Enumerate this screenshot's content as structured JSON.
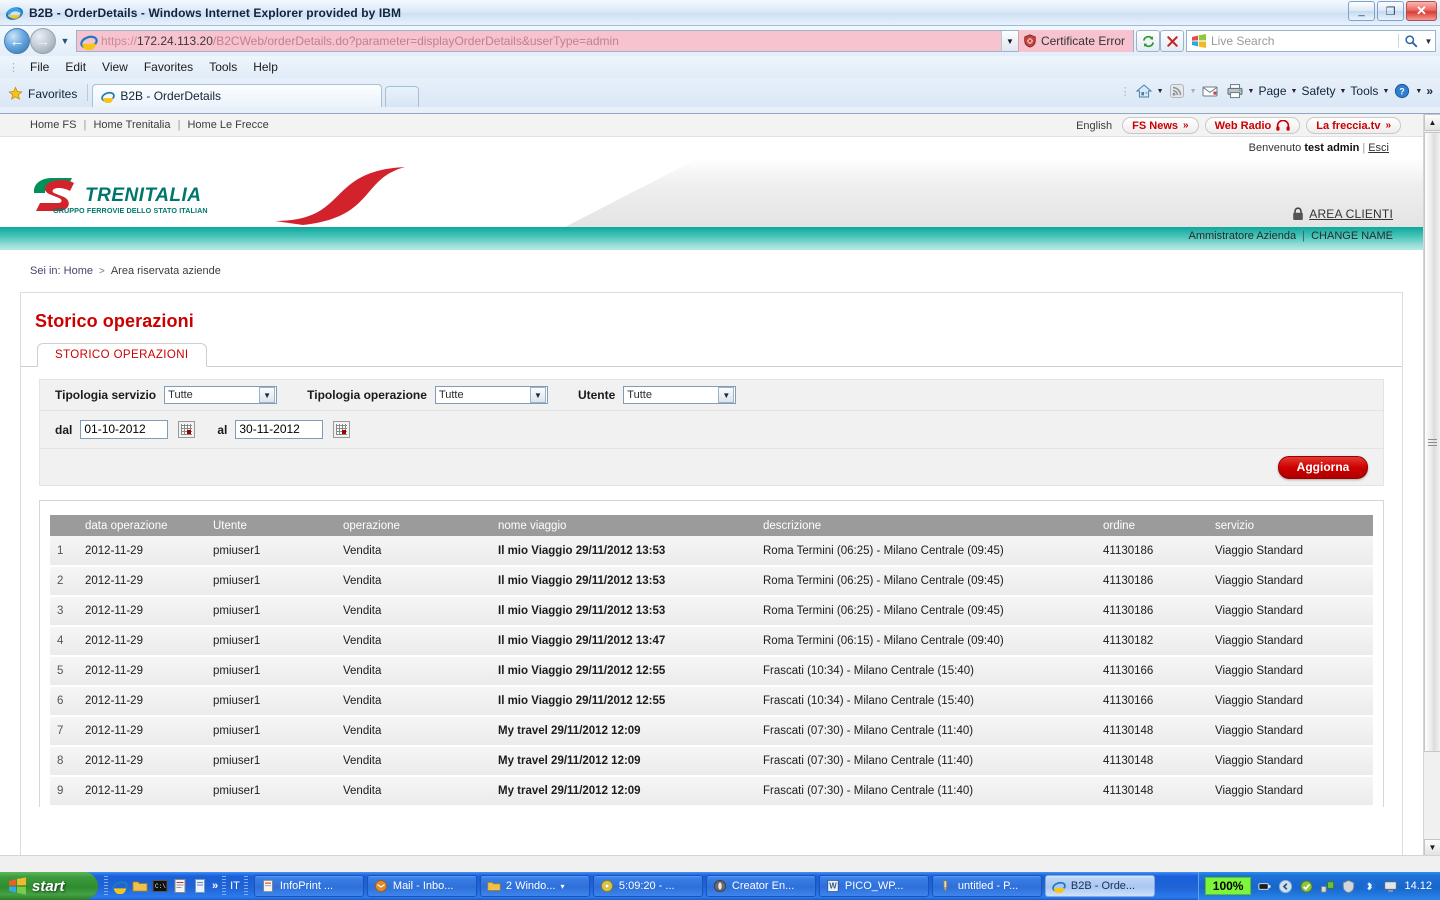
{
  "window": {
    "title": "B2B - OrderDetails - Windows Internet Explorer provided by IBM",
    "minimize": "_",
    "restore": "❐",
    "close": "✕"
  },
  "browser": {
    "url_scheme": "https://",
    "url_host": "172.24.113.20",
    "url_path": "/B2CWeb/orderDetails.do?parameter=displayOrderDetails&userType=admin",
    "certificate_error": "Certificate Error",
    "search_placeholder": "Live Search",
    "menu": [
      "File",
      "Edit",
      "View",
      "Favorites",
      "Tools",
      "Help"
    ],
    "favorites_label": "Favorites",
    "tab_label": "B2B - OrderDetails",
    "command_bar": [
      "Page",
      "Safety",
      "Tools"
    ],
    "overflow": "»"
  },
  "site": {
    "top_links": [
      "Home FS",
      "Home Trenitalia",
      "Home Le Frecce"
    ],
    "language": "English",
    "pills": [
      {
        "label": "FS News",
        "icon": "chevron-double-right-icon"
      },
      {
        "label": "Web Radio",
        "icon": "headphones-icon"
      },
      {
        "label": "La freccia.tv",
        "icon": "chevron-double-right-icon"
      }
    ],
    "welcome_prefix": "Benvenuto",
    "welcome_user": "test admin",
    "logout": "Esci",
    "logo_name": "TRENITALIA",
    "logo_tagline": "GRUPPO FERROVIE DELLO STATO ITALIANE",
    "area_clienti": "AREA CLIENTI",
    "teal_role": "Ammistratore Azienda",
    "teal_action": "CHANGE NAME",
    "breadcrumb_prefix": "Sei in:",
    "breadcrumb_home": "Home",
    "breadcrumb_current": "Area riservata aziende"
  },
  "content": {
    "page_title": "Storico operazioni",
    "tab_label": "STORICO OPERAZIONI",
    "filters": {
      "service_type_label": "Tipologia servizio",
      "service_type_value": "Tutte",
      "operation_type_label": "Tipologia operazione",
      "operation_type_value": "Tutte",
      "user_label": "Utente",
      "user_value": "Tutte",
      "from_label": "dal",
      "from_value": "01-10-2012",
      "to_label": "al",
      "to_value": "30-11-2012",
      "refresh_button": "Aggiorna"
    },
    "table": {
      "headers": [
        "",
        "data operazione",
        "Utente",
        "operazione",
        "nome viaggio",
        "descrizione",
        "ordine",
        "servizio"
      ],
      "rows": [
        {
          "n": "1",
          "data_operazione": "2012-11-29",
          "utente": "pmiuser1",
          "operazione": "Vendita",
          "nome_viaggio": "Il mio Viaggio 29/11/2012 13:53",
          "descrizione": "Roma Termini (06:25) - Milano Centrale (09:45)",
          "ordine": "41130186",
          "servizio": "Viaggio Standard"
        },
        {
          "n": "2",
          "data_operazione": "2012-11-29",
          "utente": "pmiuser1",
          "operazione": "Vendita",
          "nome_viaggio": "Il mio Viaggio 29/11/2012 13:53",
          "descrizione": "Roma Termini (06:25) - Milano Centrale (09:45)",
          "ordine": "41130186",
          "servizio": "Viaggio Standard"
        },
        {
          "n": "3",
          "data_operazione": "2012-11-29",
          "utente": "pmiuser1",
          "operazione": "Vendita",
          "nome_viaggio": "Il mio Viaggio 29/11/2012 13:53",
          "descrizione": "Roma Termini (06:25) - Milano Centrale (09:45)",
          "ordine": "41130186",
          "servizio": "Viaggio Standard"
        },
        {
          "n": "4",
          "data_operazione": "2012-11-29",
          "utente": "pmiuser1",
          "operazione": "Vendita",
          "nome_viaggio": "Il mio Viaggio 29/11/2012 13:47",
          "descrizione": "Roma Termini (06:15) - Milano Centrale (09:40)",
          "ordine": "41130182",
          "servizio": "Viaggio Standard"
        },
        {
          "n": "5",
          "data_operazione": "2012-11-29",
          "utente": "pmiuser1",
          "operazione": "Vendita",
          "nome_viaggio": "Il mio Viaggio 29/11/2012 12:55",
          "descrizione": "Frascati (10:34) - Milano Centrale (15:40)",
          "ordine": "41130166",
          "servizio": "Viaggio Standard"
        },
        {
          "n": "6",
          "data_operazione": "2012-11-29",
          "utente": "pmiuser1",
          "operazione": "Vendita",
          "nome_viaggio": "Il mio Viaggio 29/11/2012 12:55",
          "descrizione": "Frascati (10:34) - Milano Centrale (15:40)",
          "ordine": "41130166",
          "servizio": "Viaggio Standard"
        },
        {
          "n": "7",
          "data_operazione": "2012-11-29",
          "utente": "pmiuser1",
          "operazione": "Vendita",
          "nome_viaggio": "My travel 29/11/2012 12:09",
          "descrizione": "Frascati (07:30) - Milano Centrale (11:40)",
          "ordine": "41130148",
          "servizio": "Viaggio Standard"
        },
        {
          "n": "8",
          "data_operazione": "2012-11-29",
          "utente": "pmiuser1",
          "operazione": "Vendita",
          "nome_viaggio": "My travel 29/11/2012 12:09",
          "descrizione": "Frascati (07:30) - Milano Centrale (11:40)",
          "ordine": "41130148",
          "servizio": "Viaggio Standard"
        },
        {
          "n": "9",
          "data_operazione": "2012-11-29",
          "utente": "pmiuser1",
          "operazione": "Vendita",
          "nome_viaggio": "My travel 29/11/2012 12:09",
          "descrizione": "Frascati (07:30) - Milano Centrale (11:40)",
          "ordine": "41130148",
          "servizio": "Viaggio Standard"
        }
      ]
    }
  },
  "taskbar": {
    "start": "start",
    "language_indicator": "IT",
    "quicklaunch_overflow": "»",
    "tasks": [
      {
        "label": "InfoPrint ...",
        "icon": "infoprint-icon"
      },
      {
        "label": "Mail - Inbo...",
        "icon": "mail-icon"
      },
      {
        "label": "2 Windo...",
        "icon": "folder-icon"
      },
      {
        "label": "5:09:20 - ...",
        "icon": "media-icon"
      },
      {
        "label": "Creator En...",
        "icon": "creator-icon"
      },
      {
        "label": "PICO_WP...",
        "icon": "word-icon"
      },
      {
        "label": "untitled - P...",
        "icon": "paint-icon"
      },
      {
        "label": "B2B - Orde...",
        "icon": "ie-icon"
      }
    ],
    "zoom": "100%",
    "clock": "14.12"
  },
  "colors": {
    "brand_red": "#cc0000",
    "teal": "#0fa79c",
    "header_grey": "#9b9b9b",
    "address_error": "#f7c3cf"
  }
}
